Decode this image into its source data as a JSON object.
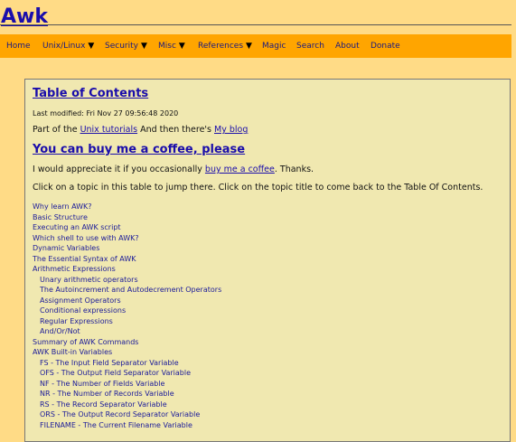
{
  "header": {
    "title": "Awk"
  },
  "nav": {
    "items": [
      {
        "label": "Home",
        "dropdown": false
      },
      {
        "label": "Unix/Linux",
        "dropdown": true
      },
      {
        "label": "Security",
        "dropdown": true
      },
      {
        "label": "Misc",
        "dropdown": true
      },
      {
        "label": "References",
        "dropdown": true
      },
      {
        "label": "Magic",
        "dropdown": false
      },
      {
        "label": "Search",
        "dropdown": false
      },
      {
        "label": "About",
        "dropdown": false
      },
      {
        "label": "Donate",
        "dropdown": false
      }
    ],
    "arrow_glyph": "▼"
  },
  "content": {
    "toc_heading": "Table of Contents",
    "last_modified": "Last modified: Fri Nov 27 09:56:48 2020",
    "part_of_prefix": "Part of the ",
    "unix_tutorials_link": "Unix tutorials",
    "blog_middle": " And then there's ",
    "blog_link": "My blog",
    "coffee_heading": "You can buy me a coffee, please",
    "appreciate_prefix": "I would appreciate it if you occasionally ",
    "coffee_link": "buy me a coffee",
    "appreciate_suffix": ". Thanks.",
    "click_instructions": "Click on a topic in this table to jump there. Click on the topic title to come back to the Table Of Contents."
  },
  "toc": [
    {
      "label": "Why learn AWK?",
      "indent": false
    },
    {
      "label": "Basic Structure",
      "indent": false
    },
    {
      "label": "Executing an AWK script",
      "indent": false
    },
    {
      "label": "Which shell to use with AWK?",
      "indent": false
    },
    {
      "label": "Dynamic Variables",
      "indent": false
    },
    {
      "label": "The Essential Syntax of AWK",
      "indent": false
    },
    {
      "label": "Arithmetic Expressions",
      "indent": false
    },
    {
      "label": "Unary arithmetic operators",
      "indent": true
    },
    {
      "label": "The Autoincrement and Autodecrement Operators",
      "indent": true
    },
    {
      "label": "Assignment Operators",
      "indent": true
    },
    {
      "label": "Conditional expressions",
      "indent": true
    },
    {
      "label": "Regular Expressions",
      "indent": true
    },
    {
      "label": "And/Or/Not",
      "indent": true
    },
    {
      "label": "Summary of AWK Commands",
      "indent": false
    },
    {
      "label": "AWK Built-in Variables",
      "indent": false
    },
    {
      "label": "FS - The Input Field Separator Variable",
      "indent": true
    },
    {
      "label": "OFS - The Output Field Separator Variable",
      "indent": true
    },
    {
      "label": "NF - The Number of Fields Variable",
      "indent": true
    },
    {
      "label": "NR - The Number of Records Variable",
      "indent": true
    },
    {
      "label": "RS - The Record Separator Variable",
      "indent": true
    },
    {
      "label": "ORS - The Output Record Separator Variable",
      "indent": true
    },
    {
      "label": "FILENAME - The Current Filename Variable",
      "indent": true
    }
  ]
}
